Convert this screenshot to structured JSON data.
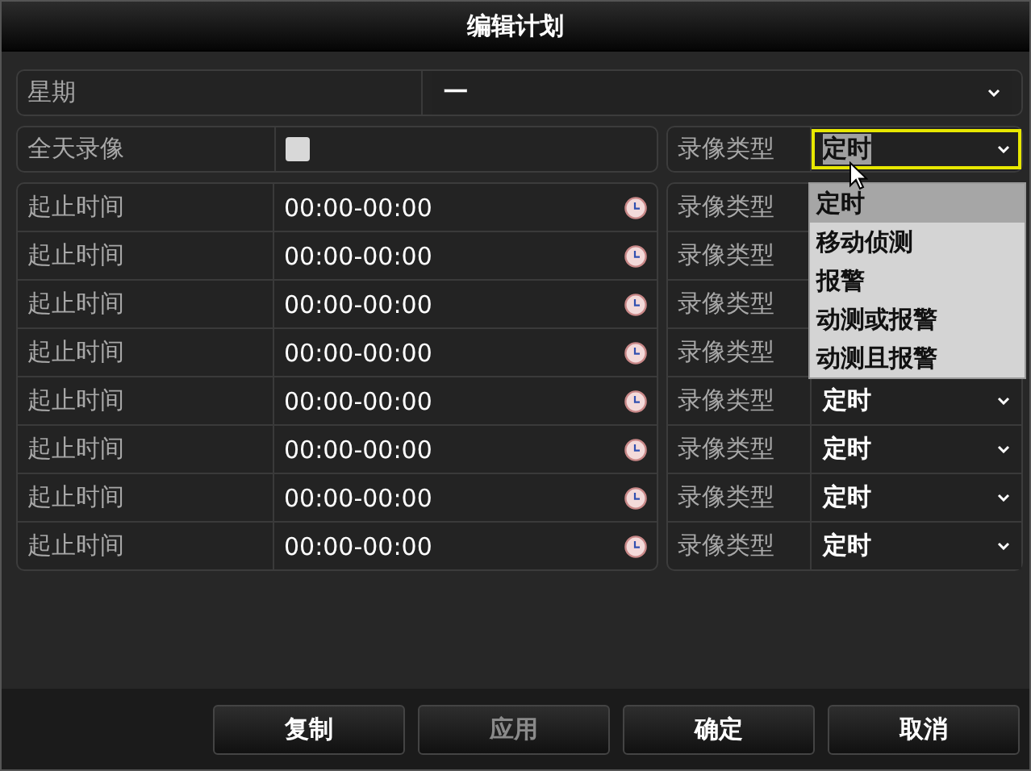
{
  "window": {
    "title": "编辑计划"
  },
  "weekday": {
    "label": "星期",
    "value": "一"
  },
  "all_day": {
    "label": "全天录像",
    "checked": false,
    "type_label": "录像类型",
    "type_value": "定时",
    "focused": true
  },
  "type_dropdown": {
    "options": [
      {
        "label": "定时",
        "selected": true
      },
      {
        "label": "移动侦测",
        "selected": false
      },
      {
        "label": "报警",
        "selected": false
      },
      {
        "label": "动测或报警",
        "selected": false
      },
      {
        "label": "动测且报警",
        "selected": false
      }
    ]
  },
  "periods": [
    {
      "label": "起止时间",
      "time": "00:00-00:00",
      "type_label": "录像类型"
    },
    {
      "label": "起止时间",
      "time": "00:00-00:00",
      "type_label": "录像类型"
    },
    {
      "label": "起止时间",
      "time": "00:00-00:00",
      "type_label": "录像类型"
    },
    {
      "label": "起止时间",
      "time": "00:00-00:00",
      "type_label": "录像类型"
    },
    {
      "label": "起止时间",
      "time": "00:00-00:00",
      "type_label": "录像类型",
      "type_value": "定时"
    },
    {
      "label": "起止时间",
      "time": "00:00-00:00",
      "type_label": "录像类型",
      "type_value": "定时"
    },
    {
      "label": "起止时间",
      "time": "00:00-00:00",
      "type_label": "录像类型",
      "type_value": "定时"
    },
    {
      "label": "起止时间",
      "time": "00:00-00:00",
      "type_label": "录像类型",
      "type_value": "定时"
    }
  ],
  "buttons": [
    {
      "label": "复制",
      "disabled": false
    },
    {
      "label": "应用",
      "disabled": true
    },
    {
      "label": "确定",
      "disabled": false
    },
    {
      "label": "取消",
      "disabled": false
    }
  ]
}
